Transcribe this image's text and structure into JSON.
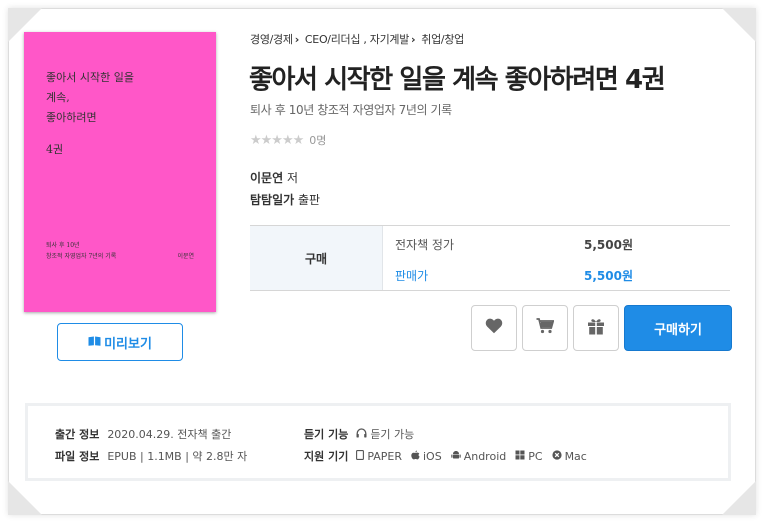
{
  "breadcrumb": {
    "items": [
      "경영/경제",
      "CEO/리더십 , 자기계발",
      "취업/창업"
    ]
  },
  "book": {
    "title": "좋아서 시작한 일을 계속 좋아하려면 4권",
    "subtitle": "퇴사 후 10년 창조적 자영업자 7년의 기록",
    "rating_count": "0명",
    "author_name": "이문연",
    "author_suffix": "저",
    "publisher_name": "탐탐일가",
    "publisher_suffix": "출판"
  },
  "cover": {
    "color": "#ff57c8",
    "line1": "좋아서 시작한 일을",
    "line2": "계속,",
    "line3": "좋아하려면",
    "volume": "4권",
    "sub1": "퇴사 후 10년",
    "sub2": "창조적 자영업자 7년의 기록",
    "author": "이문연"
  },
  "preview_button": {
    "label": "미리보기"
  },
  "price": {
    "section_label": "구매",
    "list_price_label": "전자책 정가",
    "list_price": "5,500원",
    "sale_price_label": "판매가",
    "sale_price": "5,500원"
  },
  "actions": {
    "buy_label": "구매하기",
    "wishlist_icon": "heart-icon",
    "cart_icon": "cart-icon",
    "gift_icon": "gift-icon"
  },
  "info": {
    "pub_key": "출간 정보",
    "pub_value": "2020.04.29. 전자책 출간",
    "file_key": "파일 정보",
    "file_value": "EPUB | 1.1MB | 약 2.8만 자",
    "listen_key": "듣기 기능",
    "listen_value": "듣기 가능",
    "device_key": "지원 기기",
    "devices": [
      "PAPER",
      "iOS",
      "Android",
      "PC",
      "Mac"
    ]
  },
  "colors": {
    "accent": "#1f8ce6",
    "cover": "#ff57c8"
  }
}
